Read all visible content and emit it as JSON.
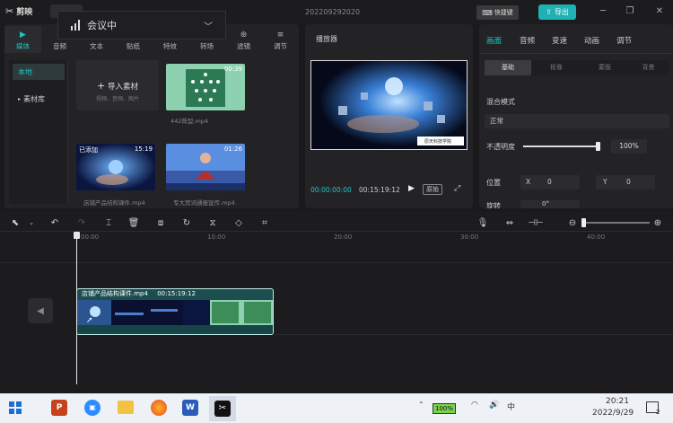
{
  "titlebar": {
    "brand": "剪映",
    "project": "202209292020",
    "shortcut": "快捷键",
    "export": "导出"
  },
  "meeting": {
    "label": "会议中"
  },
  "media": {
    "tabs": [
      {
        "label": "媒体",
        "icon": "media-icon"
      },
      {
        "label": "音频",
        "icon": "audio-icon"
      },
      {
        "label": "文本",
        "icon": "text-icon"
      },
      {
        "label": "贴纸",
        "icon": "sticker-icon"
      },
      {
        "label": "特效",
        "icon": "effects-icon"
      },
      {
        "label": "转场",
        "icon": "transition-icon"
      },
      {
        "label": "滤镜",
        "icon": "filter-icon"
      },
      {
        "label": "调节",
        "icon": "adjust-icon"
      }
    ],
    "nav": {
      "local": "本地",
      "library": "素材库"
    },
    "import": {
      "label": "导入素材",
      "hint": "视频、音频、图片"
    },
    "items": [
      {
        "name": "442阵型.mp4",
        "duration": "00:39",
        "badge": ""
      },
      {
        "name": "店铺产品结构课件.mp4",
        "duration": "15:19",
        "badge": "已添加"
      },
      {
        "name": "专大宾词通报宣传.mp4",
        "duration": "01:26",
        "badge": ""
      }
    ]
  },
  "player": {
    "title": "播放器",
    "current": "00:00:00:00",
    "total": "00:15:19:12",
    "ratio": "原始",
    "watermark": "原天科技学院"
  },
  "props": {
    "tabs": [
      "画面",
      "音频",
      "变速",
      "动画",
      "调节"
    ],
    "subtabs": [
      "基础",
      "抠像",
      "蒙版",
      "背景"
    ],
    "blend_label": "混合模式",
    "blend_value": "正常",
    "opacity_label": "不透明度",
    "opacity_value": "100%",
    "opacity": 1.0,
    "position_label": "位置",
    "x_label": "X",
    "x_value": "0",
    "y_label": "Y",
    "y_value": "0",
    "rotate_label": "旋转",
    "rotate_value": "0°"
  },
  "timeline": {
    "ruler": [
      "00:00",
      "10:00",
      "20:00",
      "30:00",
      "40:00"
    ],
    "clip": {
      "name": "店铺产品结构课件.mp4",
      "duration": "00:15:19:12"
    }
  },
  "taskbar": {
    "battery": "100%",
    "lang": "中",
    "time": "20:21",
    "date": "2022/9/29",
    "notify": "2"
  }
}
